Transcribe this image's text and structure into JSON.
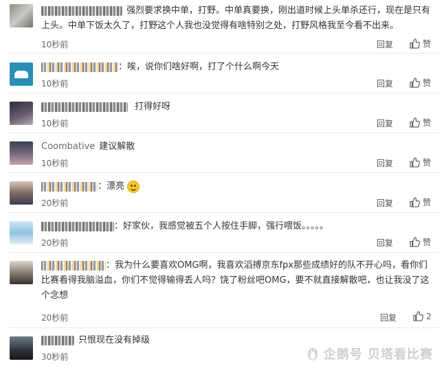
{
  "comments": [
    {
      "text": "强烈要求换中单，打野。中单真要换，刚出道时候上头单杀还行，现在是只有上头。中单下饭太久了，打野这个人我也没觉得有啥特别之处，打野风格我至今看不出来。",
      "time": "10秒前",
      "reply": "回复",
      "like": "赞"
    },
    {
      "text": "：唉，说你们啥好啊，打了个什么啊今天",
      "time": "10秒前",
      "reply": "回复",
      "like": "赞"
    },
    {
      "text": "打得好呀",
      "time": "10秒前",
      "reply": "回复",
      "like": "赞"
    },
    {
      "username": "Coombative",
      "text": "建议解散",
      "time": "10秒前",
      "reply": "回复",
      "like": "赞"
    },
    {
      "text": "：漂亮",
      "time": "20秒前",
      "reply": "回复",
      "like": "赞"
    },
    {
      "text": "：好家伙，我感觉被五个人按住手脚，强行喂饭。。。。。",
      "time": "20秒前",
      "reply": "回复",
      "like": "赞"
    },
    {
      "text": "：我为什么要喜欢OMG啊，我喜欢滔搏京东fpx那些成绩好的队不开心吗，看你们比赛看得我脑溢血，你们不觉得输得丢人吗？饶了粉丝吧OMG，要不就直接解散吧，也让我没了这个念想",
      "time": "20秒前",
      "reply": "回复",
      "like": "2"
    },
    {
      "text": "只恨现在没有掉级",
      "time": "30秒前"
    }
  ],
  "watermark": "企鹅号 贝塔看比赛",
  "icons": {
    "like": "thumbs-up-icon",
    "emoji": "smile-emoji-icon"
  }
}
